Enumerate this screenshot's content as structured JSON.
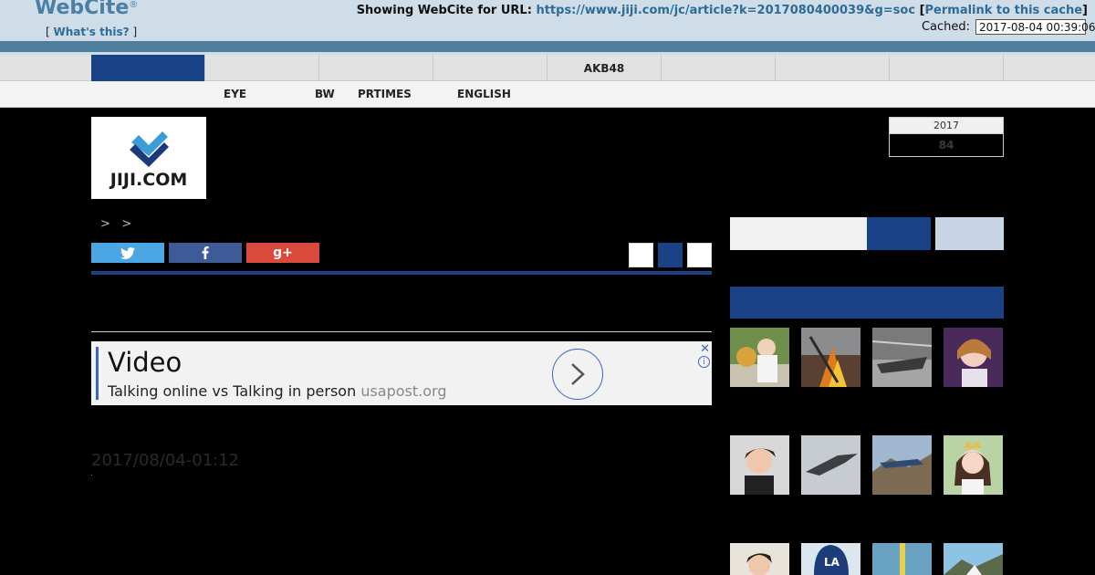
{
  "webcite": {
    "logo": "WebCite",
    "reg": "®",
    "whats_open": "[",
    "whats_link": "What's this?",
    "whats_close": "]",
    "showing_label": "Showing WebCite for URL:",
    "url": "https://www.jiji.com/jc/article?k=2017080400039&g=soc",
    "permalink_open": "[",
    "permalink": "Permalink to this cache",
    "permalink_close": "]",
    "cached_label": "Cached:",
    "cached_value": "2017-08-04 00:39:06"
  },
  "nav_top": {
    "items": [
      "",
      "",
      "",
      "",
      "AKB48",
      "",
      "",
      "",
      ""
    ]
  },
  "nav_sub": {
    "items": [
      "EYE",
      "BW",
      "PRTIMES",
      "ENGLISH"
    ]
  },
  "site": {
    "logo_text": "JIJI.COM",
    "breadcrumb_sep1": ">",
    "breadcrumb_sep2": ">"
  },
  "ad": {
    "title": "Video",
    "subtitle": "Talking online vs Talking in person",
    "domain": "usapost.org"
  },
  "article": {
    "timestamp": "2017/08/04-01:12"
  },
  "calendar": {
    "year": "2017",
    "number": "84"
  },
  "colors": {
    "brand_blue": "#1a4287",
    "webcite_blue": "#4d7f9c",
    "twitter": "#4aa7e3",
    "facebook": "#3e5b98",
    "google_plus": "#d9493c"
  }
}
